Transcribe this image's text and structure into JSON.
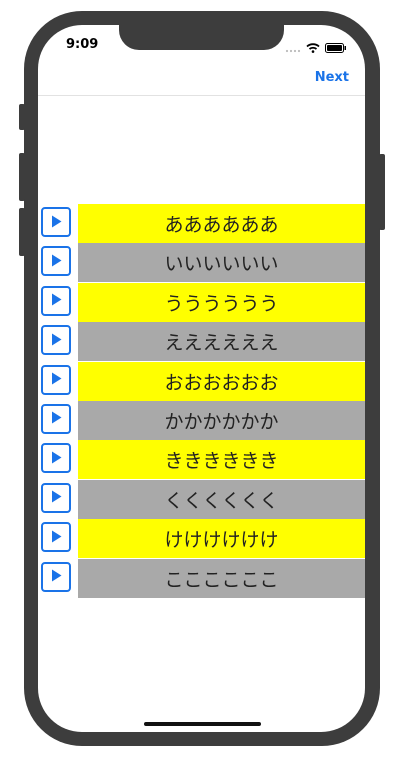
{
  "status_bar": {
    "time": "9:09"
  },
  "nav": {
    "next_label": "Next"
  },
  "rows": [
    {
      "label": "ああああああ",
      "color": "#ffff00"
    },
    {
      "label": "いいいいいい",
      "color": "#a9a9a9"
    },
    {
      "label": "うううううう",
      "color": "#ffff00"
    },
    {
      "label": "ええええええ",
      "color": "#a9a9a9"
    },
    {
      "label": "おおおおおお",
      "color": "#ffff00"
    },
    {
      "label": "かかかかかか",
      "color": "#a9a9a9"
    },
    {
      "label": "きききききき",
      "color": "#ffff00"
    },
    {
      "label": "くくくくくく",
      "color": "#a9a9a9"
    },
    {
      "label": "けけけけけけ",
      "color": "#ffff00"
    },
    {
      "label": "ここここここ",
      "color": "#a9a9a9"
    }
  ],
  "icons": {
    "play": "play-icon",
    "accent": "#1a73e8"
  }
}
